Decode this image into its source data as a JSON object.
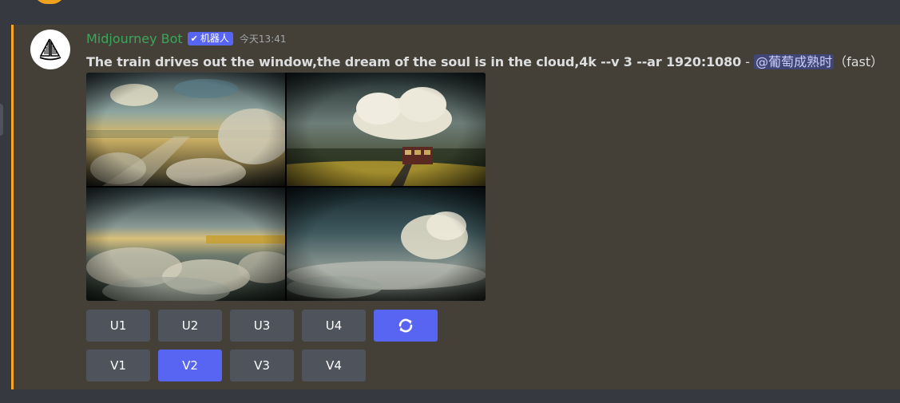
{
  "message": {
    "author": "Midjourney Bot",
    "bot_tag": "机器人",
    "timestamp": "今天13:41",
    "prompt": "The train drives out the window,the dream of the soul is in the cloud,4k --v 3 --ar 1920:1080",
    "separator": " - ",
    "mention": "@葡萄成熟时",
    "speed": "（fast）"
  },
  "buttons": {
    "row1": [
      "U1",
      "U2",
      "U3",
      "U4"
    ],
    "row2": [
      "V1",
      "V2",
      "V3",
      "V4"
    ],
    "reroll_icon": "refresh-icon"
  },
  "colors": {
    "username": "#3ba55c",
    "accent": "#5865f2",
    "highlight_border": "#faa61a"
  }
}
